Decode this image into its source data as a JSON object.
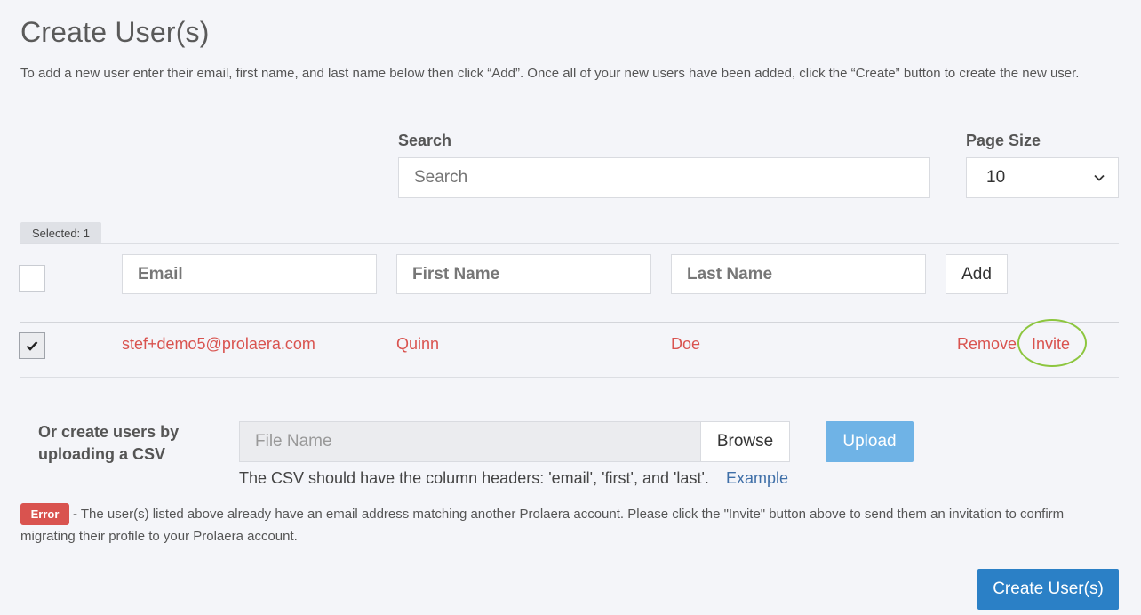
{
  "page": {
    "title": "Create User(s)",
    "instructions": "To add a new user enter their email, first name, and last name below then click “Add”. Once all of your new users have been added, click the “Create” button to create the new user."
  },
  "search": {
    "label": "Search",
    "placeholder": "Search"
  },
  "page_size": {
    "label": "Page Size",
    "value": "10",
    "icon": "chevron-down-icon"
  },
  "selection": {
    "badge": "Selected: 1"
  },
  "new_user_form": {
    "email_placeholder": "Email",
    "first_placeholder": "First Name",
    "last_placeholder": "Last Name",
    "add_label": "Add"
  },
  "users": [
    {
      "checked": true,
      "email": "stef+demo5@prolaera.com",
      "first": "Quinn",
      "last": "Doe",
      "remove_label": "Remove",
      "invite_label": "Invite"
    }
  ],
  "csv": {
    "label": "Or create users by uploading a CSV",
    "file_placeholder": "File Name",
    "browse_label": "Browse",
    "upload_label": "Upload",
    "help_text": "The CSV should have the column headers: 'email', 'first', and 'last'.",
    "example_label": "Example"
  },
  "error": {
    "badge": "Error",
    "message": "- The user(s) listed above already have an email address matching another Prolaera account. Please click the \"Invite\" button above to send them an invitation to confirm migrating their profile to your Prolaera account."
  },
  "actions": {
    "create_label": "Create User(s)"
  },
  "colors": {
    "background": "#f4f5f9",
    "danger": "#d9534f",
    "primary": "#2b80c6",
    "upload": "#6fb3e6",
    "highlight": "#8dc63f",
    "link": "#3f6fa8"
  }
}
